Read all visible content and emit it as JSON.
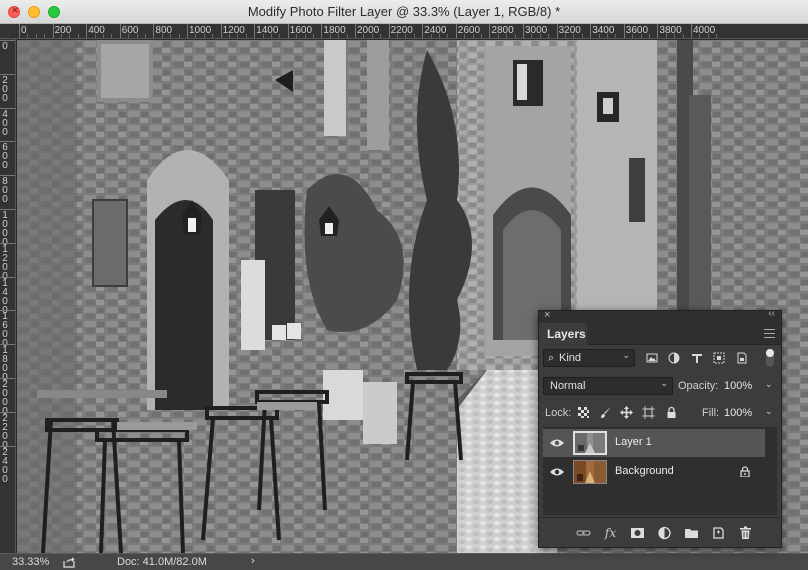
{
  "window": {
    "title": "Modify Photo Filter Layer @ 33.3% (Layer 1, RGB/8) *",
    "close_glyph": "×"
  },
  "ruler": {
    "horizontal": [
      "0",
      "200",
      "400",
      "600",
      "800",
      "1000",
      "1200",
      "1400",
      "1600",
      "1800",
      "2000",
      "2200",
      "2400",
      "2600",
      "2800",
      "3000",
      "3200",
      "3400",
      "3600",
      "3800",
      "4000"
    ],
    "vertical": [
      "0",
      "200",
      "400",
      "600",
      "800",
      "1000",
      "1200",
      "1400",
      "1600",
      "1800",
      "2000",
      "2200",
      "2400"
    ]
  },
  "status": {
    "zoom": "33.33%",
    "doc": "Doc: 41.0M/82.0M",
    "arrow": "›"
  },
  "layers_panel": {
    "tab": "Layers",
    "close_glyph": "×",
    "collapse_glyph": "‹‹",
    "kind_label": "Kind",
    "kind_search_glyph": "⌕",
    "blend_mode": "Normal",
    "opacity_label": "Opacity:",
    "opacity_value": "100%",
    "lock_label": "Lock:",
    "fill_label": "Fill:",
    "fill_value": "100%",
    "chevron": "⌄",
    "filter_icons": [
      "image-filter-icon",
      "adjustment-filter-icon",
      "type-filter-icon",
      "shape-filter-icon",
      "smart-object-filter-icon"
    ],
    "layers": [
      {
        "name": "Layer 1",
        "selected": true,
        "visible": true,
        "locked": false
      },
      {
        "name": "Background",
        "selected": false,
        "visible": true,
        "locked": true
      }
    ],
    "footer_icons": [
      "link-layers-icon",
      "fx-icon",
      "mask-icon",
      "adjustment-layer-icon",
      "group-folder-icon",
      "new-layer-icon",
      "trash-icon"
    ],
    "fx_label": "fx"
  },
  "colors": {
    "panel_bg": "#3c3c3c",
    "selected_row": "#555555",
    "canvas_bg": "#777777"
  }
}
